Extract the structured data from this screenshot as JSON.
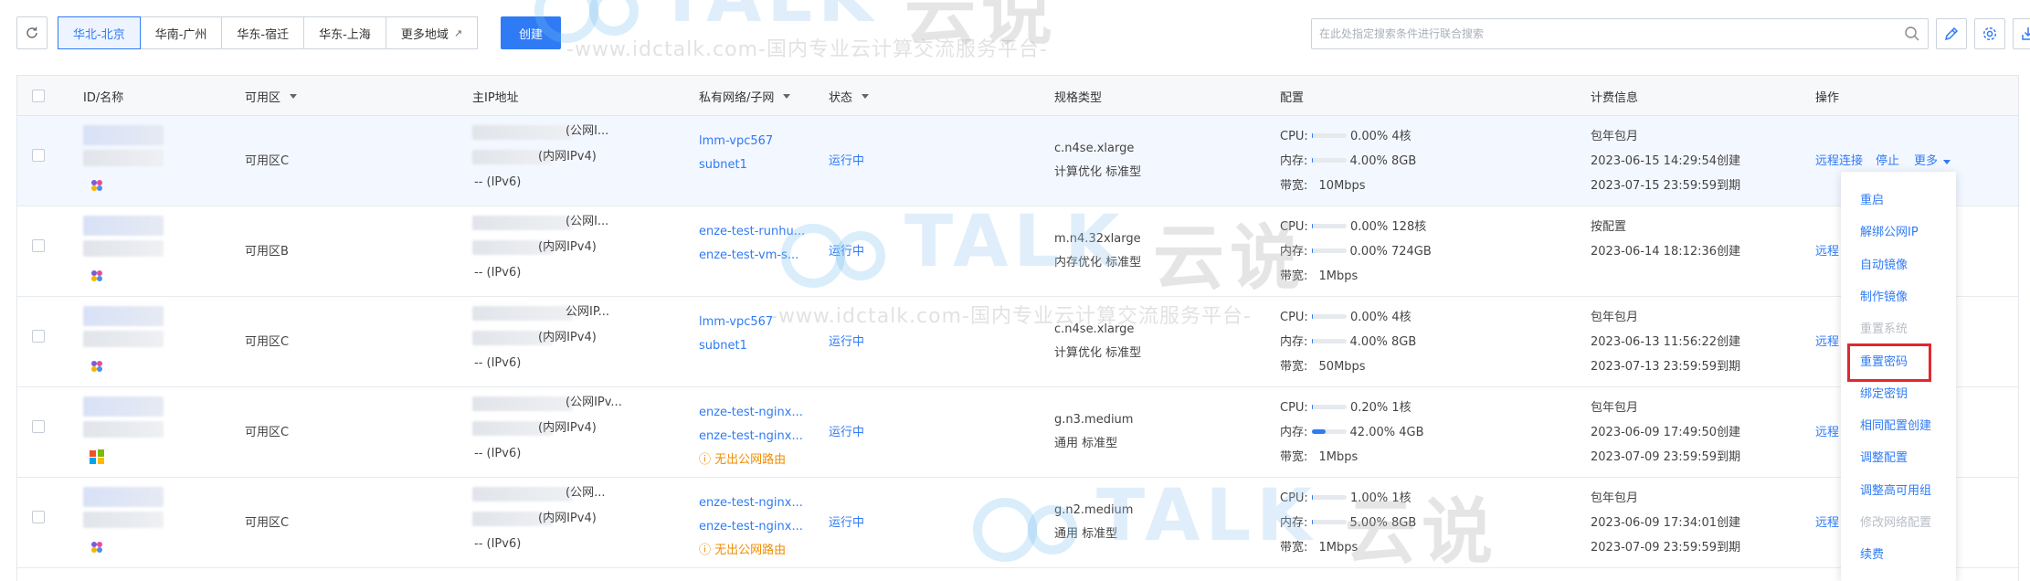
{
  "toolbar": {
    "regions": [
      {
        "label": "华北-北京",
        "active": true
      },
      {
        "label": "华南-广州",
        "active": false
      },
      {
        "label": "华东-宿迁",
        "active": false
      },
      {
        "label": "华东-上海",
        "active": false
      },
      {
        "label": "更多地域",
        "active": false
      }
    ],
    "create_label": "创建",
    "search_placeholder": "在此处指定搜索条件进行联合搜索"
  },
  "table": {
    "headers": {
      "id_name": "ID/名称",
      "zone": "可用区",
      "ip": "主IP地址",
      "vpc": "私有网络/子网",
      "status": "状态",
      "spec": "规格类型",
      "config": "配置",
      "billing": "计费信息",
      "actions": "操作"
    },
    "rows": [
      {
        "os": "linux",
        "zone": "可用区C",
        "ip_public": "(公网I...",
        "ip_private": "(内网IPv4)",
        "ip_v6": "-- (IPv6)",
        "vpc": "lmm-vpc567",
        "subnet": "subnet1",
        "no_public_route": "",
        "status": "运行中",
        "spec_name": "c.n4se.xlarge",
        "spec_type": "计算优化 标准型",
        "cpu_label": "CPU:",
        "cpu_pct": "0.00%",
        "cpu_val": "4核",
        "cpu_fill": 0.0,
        "mem_label": "内存:",
        "mem_pct": "4.00%",
        "mem_val": "8GB",
        "mem_fill": 0.04,
        "bw_label": "带宽:",
        "bw_val": "10Mbps",
        "billing_type": "包年包月",
        "created": "2023-06-15 14:29:54创建",
        "expires": "2023-07-15 23:59:59到期",
        "action_remote": "远程连接",
        "action_stop": "停止",
        "action_more": "更多"
      },
      {
        "os": "linux",
        "zone": "可用区B",
        "ip_public": "(公网I...",
        "ip_private": "(内网IPv4)",
        "ip_v6": "-- (IPv6)",
        "vpc": "enze-test-runhu...",
        "subnet": "enze-test-vm-s...",
        "no_public_route": "",
        "status": "运行中",
        "spec_name": "m.n4.32xlarge",
        "spec_type": "内存优化 标准型",
        "cpu_label": "CPU:",
        "cpu_pct": "0.00%",
        "cpu_val": "128核",
        "cpu_fill": 0.0,
        "mem_label": "内存:",
        "mem_pct": "0.00%",
        "mem_val": "724GB",
        "mem_fill": 0.0,
        "bw_label": "带宽:",
        "bw_val": "1Mbps",
        "billing_type": "按配置",
        "created": "2023-06-14 18:12:36创建",
        "expires": "",
        "action_remote": "远程",
        "action_stop": "",
        "action_more": ""
      },
      {
        "os": "linux",
        "zone": "可用区C",
        "ip_public": "公网IP...",
        "ip_private": "(内网IPv4)",
        "ip_v6": "-- (IPv6)",
        "vpc": "lmm-vpc567",
        "subnet": "subnet1",
        "no_public_route": "",
        "status": "运行中",
        "spec_name": "c.n4se.xlarge",
        "spec_type": "计算优化 标准型",
        "cpu_label": "CPU:",
        "cpu_pct": "0.00%",
        "cpu_val": "4核",
        "cpu_fill": 0.0,
        "mem_label": "内存:",
        "mem_pct": "4.00%",
        "mem_val": "8GB",
        "mem_fill": 0.04,
        "bw_label": "带宽:",
        "bw_val": "50Mbps",
        "billing_type": "包年包月",
        "created": "2023-06-13 11:56:22创建",
        "expires": "2023-07-13 23:59:59到期",
        "action_remote": "远程",
        "action_stop": "",
        "action_more": ""
      },
      {
        "os": "windows",
        "zone": "可用区C",
        "ip_public": "(公网IPv...",
        "ip_private": "(内网IPv4)",
        "ip_v6": "-- (IPv6)",
        "vpc": "enze-test-nginx...",
        "subnet": "enze-test-nginx...",
        "no_public_route": "无出公网路由",
        "status": "运行中",
        "spec_name": "g.n3.medium",
        "spec_type": "通用 标准型",
        "cpu_label": "CPU:",
        "cpu_pct": "0.20%",
        "cpu_val": "1核",
        "cpu_fill": 0.002,
        "mem_label": "内存:",
        "mem_pct": "42.00%",
        "mem_val": "4GB",
        "mem_fill": 0.42,
        "bw_label": "带宽:",
        "bw_val": "1Mbps",
        "billing_type": "包年包月",
        "created": "2023-06-09 17:49:50创建",
        "expires": "2023-07-09 23:59:59到期",
        "action_remote": "远程",
        "action_stop": "",
        "action_more": ""
      },
      {
        "os": "linux",
        "zone": "可用区C",
        "ip_public": "(公网...",
        "ip_private": "(内网IPv4)",
        "ip_v6": "-- (IPv6)",
        "vpc": "enze-test-nginx...",
        "subnet": "enze-test-nginx...",
        "no_public_route": "无出公网路由",
        "status": "运行中",
        "spec_name": "g.n2.medium",
        "spec_type": "通用 标准型",
        "cpu_label": "CPU:",
        "cpu_pct": "1.00%",
        "cpu_val": "1核",
        "cpu_fill": 0.01,
        "mem_label": "内存:",
        "mem_pct": "5.00%",
        "mem_val": "8GB",
        "mem_fill": 0.05,
        "bw_label": "带宽:",
        "bw_val": "1Mbps",
        "billing_type": "包年包月",
        "created": "2023-06-09 17:34:01创建",
        "expires": "2023-07-09 23:59:59到期",
        "action_remote": "远程",
        "action_stop": "",
        "action_more": ""
      }
    ]
  },
  "more_menu": {
    "items": [
      {
        "label": "重启",
        "disabled": false
      },
      {
        "label": "解绑公网IP",
        "disabled": false
      },
      {
        "label": "自动镜像",
        "disabled": false
      },
      {
        "label": "制作镜像",
        "disabled": false
      },
      {
        "label": "重置系统",
        "disabled": true
      },
      {
        "label": "重置密码",
        "disabled": false
      },
      {
        "label": "绑定密钥",
        "disabled": false
      },
      {
        "label": "相同配置创建",
        "disabled": false
      },
      {
        "label": "调整配置",
        "disabled": false
      },
      {
        "label": "调整高可用组",
        "disabled": false
      },
      {
        "label": "修改网络配置",
        "disabled": true
      },
      {
        "label": "续费",
        "disabled": false
      }
    ]
  },
  "watermarks": {
    "url_text": "-www.idctalk.com-国内专业云计算交流服务平台-",
    "logo_latin": "TALK",
    "logo_cn": "云说"
  },
  "colors": {
    "accent": "#2f7bf5",
    "warning": "#f08c00",
    "highlight": "#e0282e"
  }
}
